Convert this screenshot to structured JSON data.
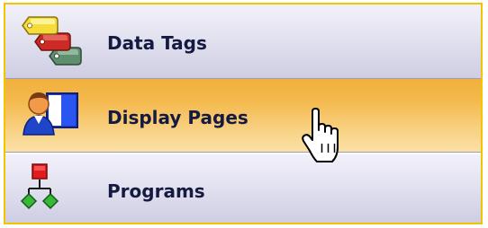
{
  "nav": {
    "items": [
      {
        "label": "Data Tags",
        "icon": "data-tags-icon",
        "selected": false
      },
      {
        "label": "Display Pages",
        "icon": "display-pages-icon",
        "selected": true
      },
      {
        "label": "Programs",
        "icon": "programs-icon",
        "selected": false
      }
    ],
    "cursor": "hand-pointer"
  },
  "colors": {
    "border": "#f3c400",
    "active_top": "#f0b03c",
    "active_bottom": "#fbe1a6",
    "normal_top": "#f2f1fb",
    "normal_bottom": "#cfcde2",
    "label_text": "#151a40"
  }
}
